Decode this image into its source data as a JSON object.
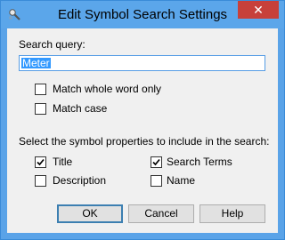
{
  "window": {
    "title": "Edit Symbol Search Settings",
    "close_label": "✕"
  },
  "query": {
    "label": "Search query:",
    "value": "Meter"
  },
  "match_options": [
    {
      "label": "Match whole word only",
      "checked": false
    },
    {
      "label": "Match case",
      "checked": false
    }
  ],
  "properties": {
    "label": "Select the symbol properties to include in the search:",
    "items": [
      {
        "label": "Title",
        "checked": true
      },
      {
        "label": "Search Terms",
        "checked": true
      },
      {
        "label": "Description",
        "checked": false
      },
      {
        "label": "Name",
        "checked": false
      }
    ]
  },
  "buttons": {
    "ok": "OK",
    "cancel": "Cancel",
    "help": "Help"
  },
  "colors": {
    "titlebar": "#5ba6ea",
    "close": "#c7403a",
    "selection": "#3399ff"
  }
}
